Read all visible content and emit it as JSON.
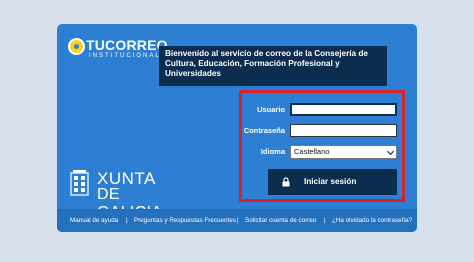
{
  "brand": {
    "title": "TUCORREO",
    "subtitle": "INSTITUCIONAL"
  },
  "welcome_message": "Bienvenido al servicio de correo de la Consejería de Cultura, Educación, Formación Profesional y Universidades",
  "login_form": {
    "user_label": "Usuario",
    "user_value": "",
    "password_label": "Contraseña",
    "password_value": "",
    "language_label": "Idioma",
    "language_selected": "Castellano",
    "submit_label": "Iniciar sesión"
  },
  "xunta_logo": {
    "line1": "XUNTA",
    "line2": "DE GALICIA"
  },
  "footer_links": [
    "Manual de ayuda",
    "Preguntas y Respuestas Frecuentes",
    "Solicitar cuenta de correo",
    "¿Ha olvidado la contraseña?"
  ],
  "footer_separator": "|",
  "colors": {
    "panel": "#2d7fd3",
    "dark_navy": "#0c2d4f",
    "highlight_border": "#d8232a",
    "page_background": "#d7e1ec"
  },
  "icons": {
    "logo_badge": "tucorreo-badge-icon",
    "login_button": "lock-icon",
    "select": "chevron-down-icon",
    "xunta": "xunta-emblem-icon"
  }
}
